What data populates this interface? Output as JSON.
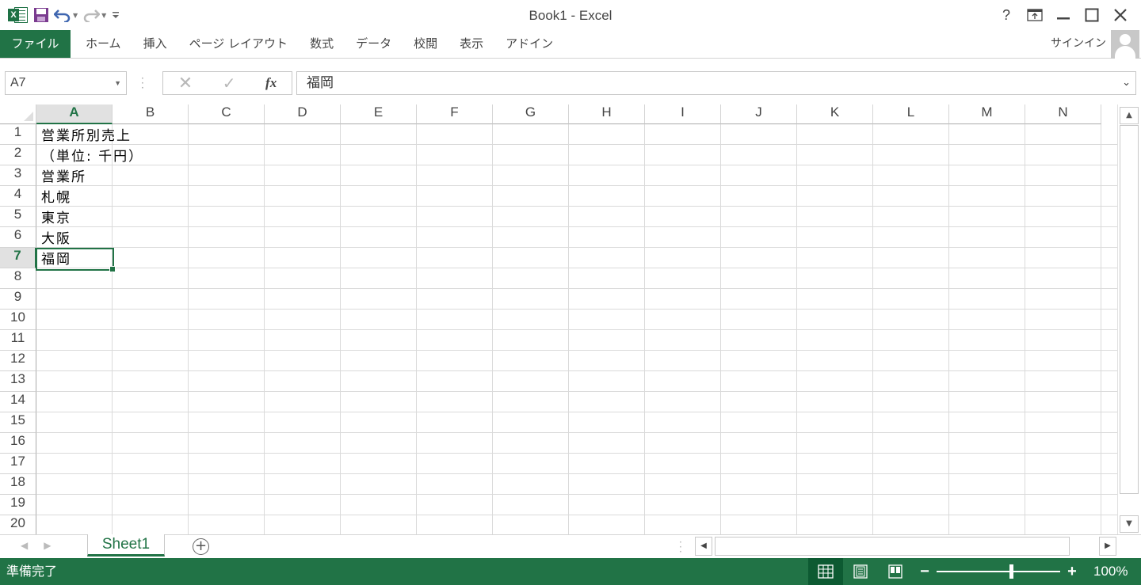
{
  "window": {
    "title": "Book1 - Excel"
  },
  "qat": {
    "logo_letter": "X"
  },
  "ribbon": {
    "file_tab": "ファイル",
    "tabs": [
      "ホーム",
      "挿入",
      "ページ レイアウト",
      "数式",
      "データ",
      "校閲",
      "表示",
      "アドイン"
    ],
    "signin": "サインイン",
    "help": "?"
  },
  "formula_bar": {
    "name_box": "A7",
    "fx_label": "fx",
    "content": "福岡"
  },
  "grid": {
    "columns": [
      "A",
      "B",
      "C",
      "D",
      "E",
      "F",
      "G",
      "H",
      "I",
      "J",
      "K",
      "L",
      "M",
      "N"
    ],
    "rows": [
      "1",
      "2",
      "3",
      "4",
      "5",
      "6",
      "7",
      "8",
      "9",
      "10",
      "11",
      "12",
      "13",
      "14",
      "15",
      "16",
      "17",
      "18",
      "19",
      "20"
    ],
    "active_column": "A",
    "active_row": "7",
    "cells": [
      {
        "ref": "A1",
        "value": "営業所別売上"
      },
      {
        "ref": "A2",
        "value": "（単位: 千円）"
      },
      {
        "ref": "A3",
        "value": "営業所"
      },
      {
        "ref": "A4",
        "value": "札幌"
      },
      {
        "ref": "A5",
        "value": "東京"
      },
      {
        "ref": "A6",
        "value": "大阪"
      },
      {
        "ref": "A7",
        "value": "福岡"
      }
    ]
  },
  "sheets": {
    "tabs": [
      "Sheet1"
    ],
    "add_label": "+"
  },
  "status": {
    "text": "準備完了",
    "zoom": "100%",
    "zoom_minus": "−",
    "zoom_plus": "+"
  },
  "colors": {
    "accent": "#217346",
    "gridline": "#dadada"
  }
}
